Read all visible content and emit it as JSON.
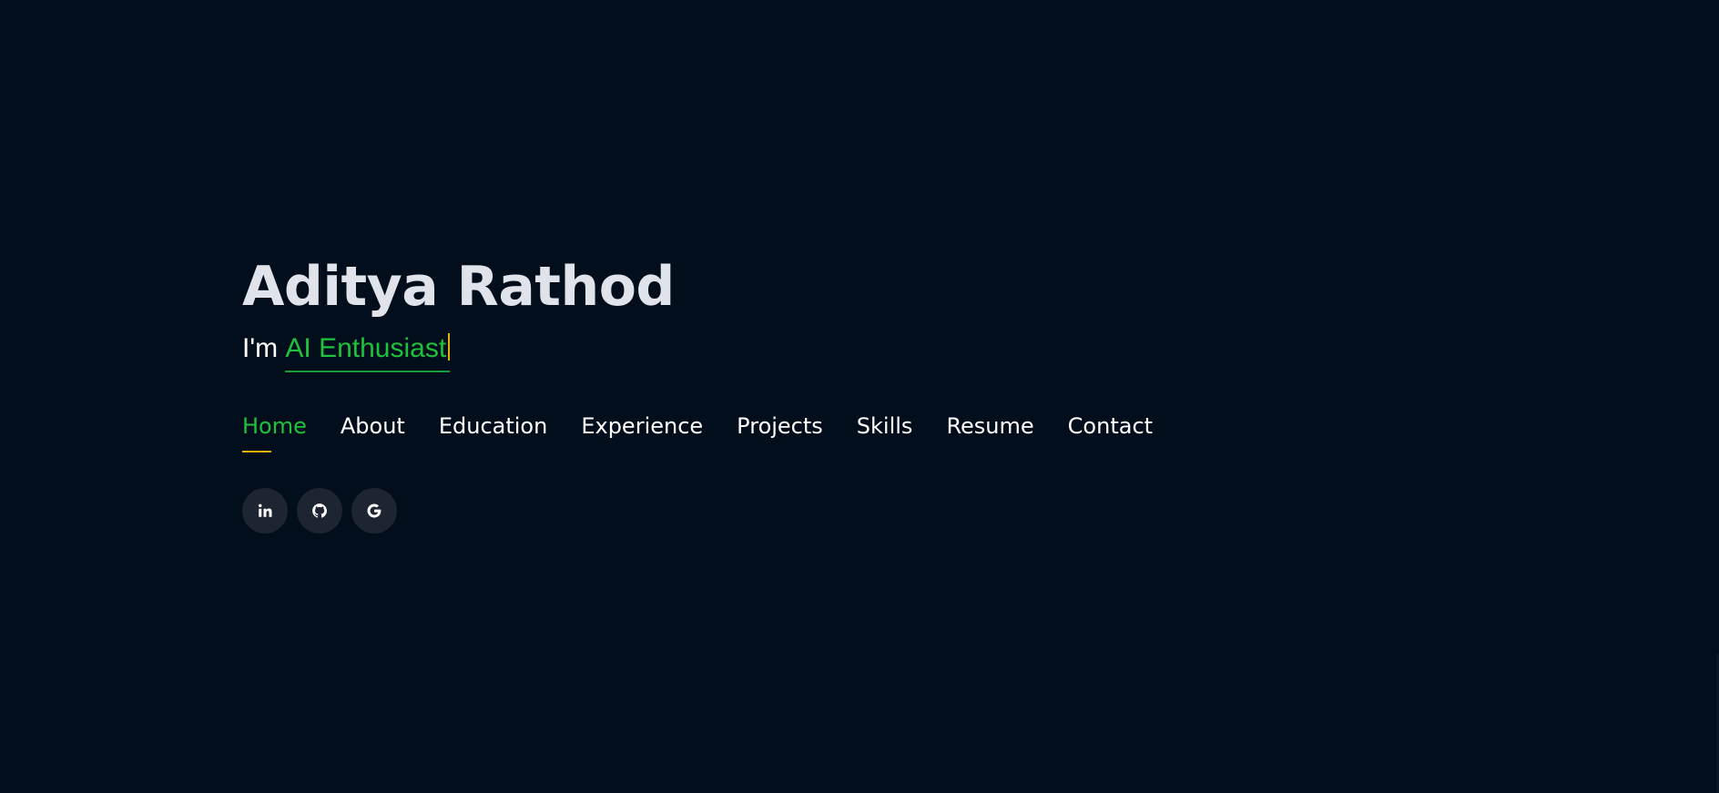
{
  "hero": {
    "name": "Aditya Rathod",
    "typed_prefix": "I'm",
    "typed_text": "AI Enthusiast"
  },
  "nav": {
    "items": [
      {
        "label": "Home",
        "active": true
      },
      {
        "label": "About",
        "active": false
      },
      {
        "label": "Education",
        "active": false
      },
      {
        "label": "Experience",
        "active": false
      },
      {
        "label": "Projects",
        "active": false
      },
      {
        "label": "Skills",
        "active": false
      },
      {
        "label": "Resume",
        "active": false
      },
      {
        "label": "Contact",
        "active": false
      }
    ]
  },
  "socials": [
    {
      "icon": "linkedin-icon"
    },
    {
      "icon": "github-icon"
    },
    {
      "icon": "google-icon"
    }
  ],
  "colors": {
    "background": "#020e1b",
    "accent_green": "#1ec23c",
    "accent_gold": "#e2b007",
    "text": "#ffffff",
    "social_bg": "#1c2531"
  }
}
